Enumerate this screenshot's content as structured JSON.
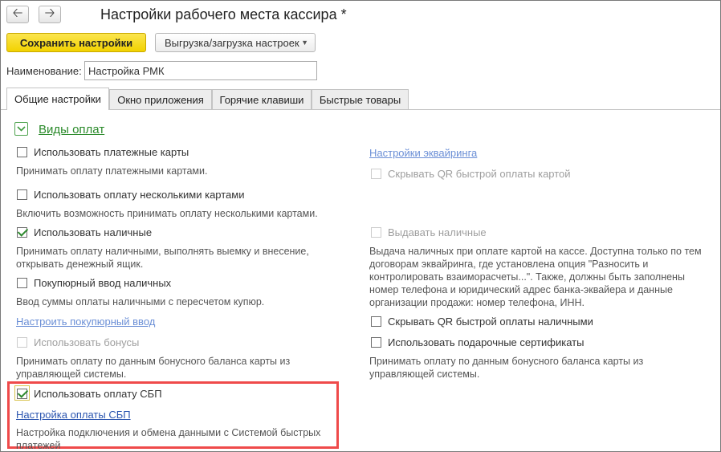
{
  "window": {
    "title": "Настройки рабочего места кассира *",
    "nav": {
      "back_icon": "arrow-left-icon",
      "forward_icon": "arrow-right-icon"
    }
  },
  "toolbar": {
    "save_label": "Сохранить настройки",
    "export_label": "Выгрузка/загрузка настроек"
  },
  "name_field": {
    "label": "Наименование:",
    "value": "Настройка РМК"
  },
  "tabs": [
    {
      "label": "Общие настройки",
      "active": true
    },
    {
      "label": "Окно приложения",
      "active": false
    },
    {
      "label": "Горячие клавиши",
      "active": false
    },
    {
      "label": "Быстрые товары",
      "active": false
    }
  ],
  "section": {
    "title": "Виды оплат",
    "expanded": true
  },
  "left": {
    "cards": {
      "label": "Использовать платежные карты",
      "checked": false,
      "desc": "Принимать оплату платежными картами."
    },
    "multi_cards": {
      "label": "Использовать оплату несколькими картами",
      "checked": false,
      "desc": "Включить возможность принимать оплату несколькими картами."
    },
    "cash": {
      "label": "Использовать наличные",
      "checked": true,
      "desc": "Принимать оплату наличными, выполнять выемку и внесение, открывать денежный ящик."
    },
    "buyer_cash": {
      "label": "Покупюрный ввод наличных",
      "checked": false,
      "desc": "Ввод суммы оплаты наличными с пересчетом купюр.",
      "link": "Настроить покупюрный ввод"
    },
    "bonus": {
      "label": "Использовать бонусы",
      "checked": false,
      "disabled": true,
      "desc": "Принимать оплату по данным бонусного баланса карты из управляющей системы."
    },
    "sbp": {
      "label": "Использовать оплату СБП",
      "checked": true,
      "link": "Настройка оплаты СБП",
      "desc": "Настройка подключения и обмена данными с Системой быстрых платежей"
    }
  },
  "right": {
    "acquiring_link": "Настройки эквайринга",
    "hide_qr_card": {
      "label": "Скрывать QR быстрой оплаты картой",
      "checked": false,
      "disabled": true
    },
    "cash_out": {
      "label": "Выдавать наличные",
      "checked": false,
      "disabled": true,
      "desc": "Выдача наличных при оплате картой на кассе. Доступна только по тем договорам эквайринга, где установлена опция \"Разносить и контролировать взаиморасчеты...\". Также, должны быть заполнены номер телефона и юридический адрес банка-эквайера и данные организации продажи: номер телефона, ИНН."
    },
    "hide_qr_cash": {
      "label": "Скрывать QR быстрой оплаты наличными",
      "checked": false
    },
    "gift_certs": {
      "label": "Использовать подарочные сертификаты",
      "checked": false,
      "desc": "Принимать оплату по данным бонусного баланса карты из управляющей системы."
    }
  },
  "colors": {
    "save_button": "#f2d200",
    "section_green": "#2a8a2a",
    "link_blue": "#6b8fd6",
    "highlight_red": "#ef4a4a"
  }
}
